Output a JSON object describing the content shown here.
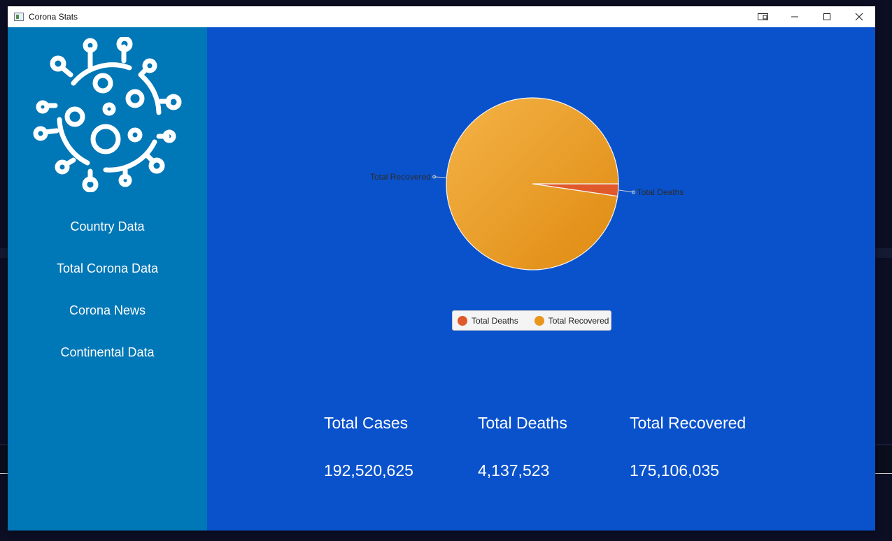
{
  "window": {
    "title": "Corona Stats",
    "controls": {
      "snap": "▭",
      "minimize": "—",
      "maximize": "☐",
      "close": "✕"
    }
  },
  "sidebar": {
    "logo_icon": "virus-icon",
    "items": [
      {
        "label": "Country Data"
      },
      {
        "label": "Total Corona Data"
      },
      {
        "label": "Corona News"
      },
      {
        "label": "Continental Data"
      }
    ]
  },
  "chart_data": {
    "type": "pie",
    "slices": [
      {
        "label": "Total Deaths",
        "value": 4137523,
        "color": "#e0592b"
      },
      {
        "label": "Total Recovered",
        "value": 175106035,
        "color": "#e8961c"
      }
    ],
    "legend": [
      "Total Deaths",
      "Total Recovered"
    ],
    "legend_placement": "bottom"
  },
  "stats": [
    {
      "label": "Total Cases",
      "value": "192,520,625"
    },
    {
      "label": "Total Deaths",
      "value": "4,137,523"
    },
    {
      "label": "Total Recovered",
      "value": "175,106,035"
    }
  ],
  "colors": {
    "sidebar_bg": "#0077b6",
    "main_bg": "#0a52cc",
    "deaths": "#e0592b",
    "recovered": "#e8961c"
  }
}
